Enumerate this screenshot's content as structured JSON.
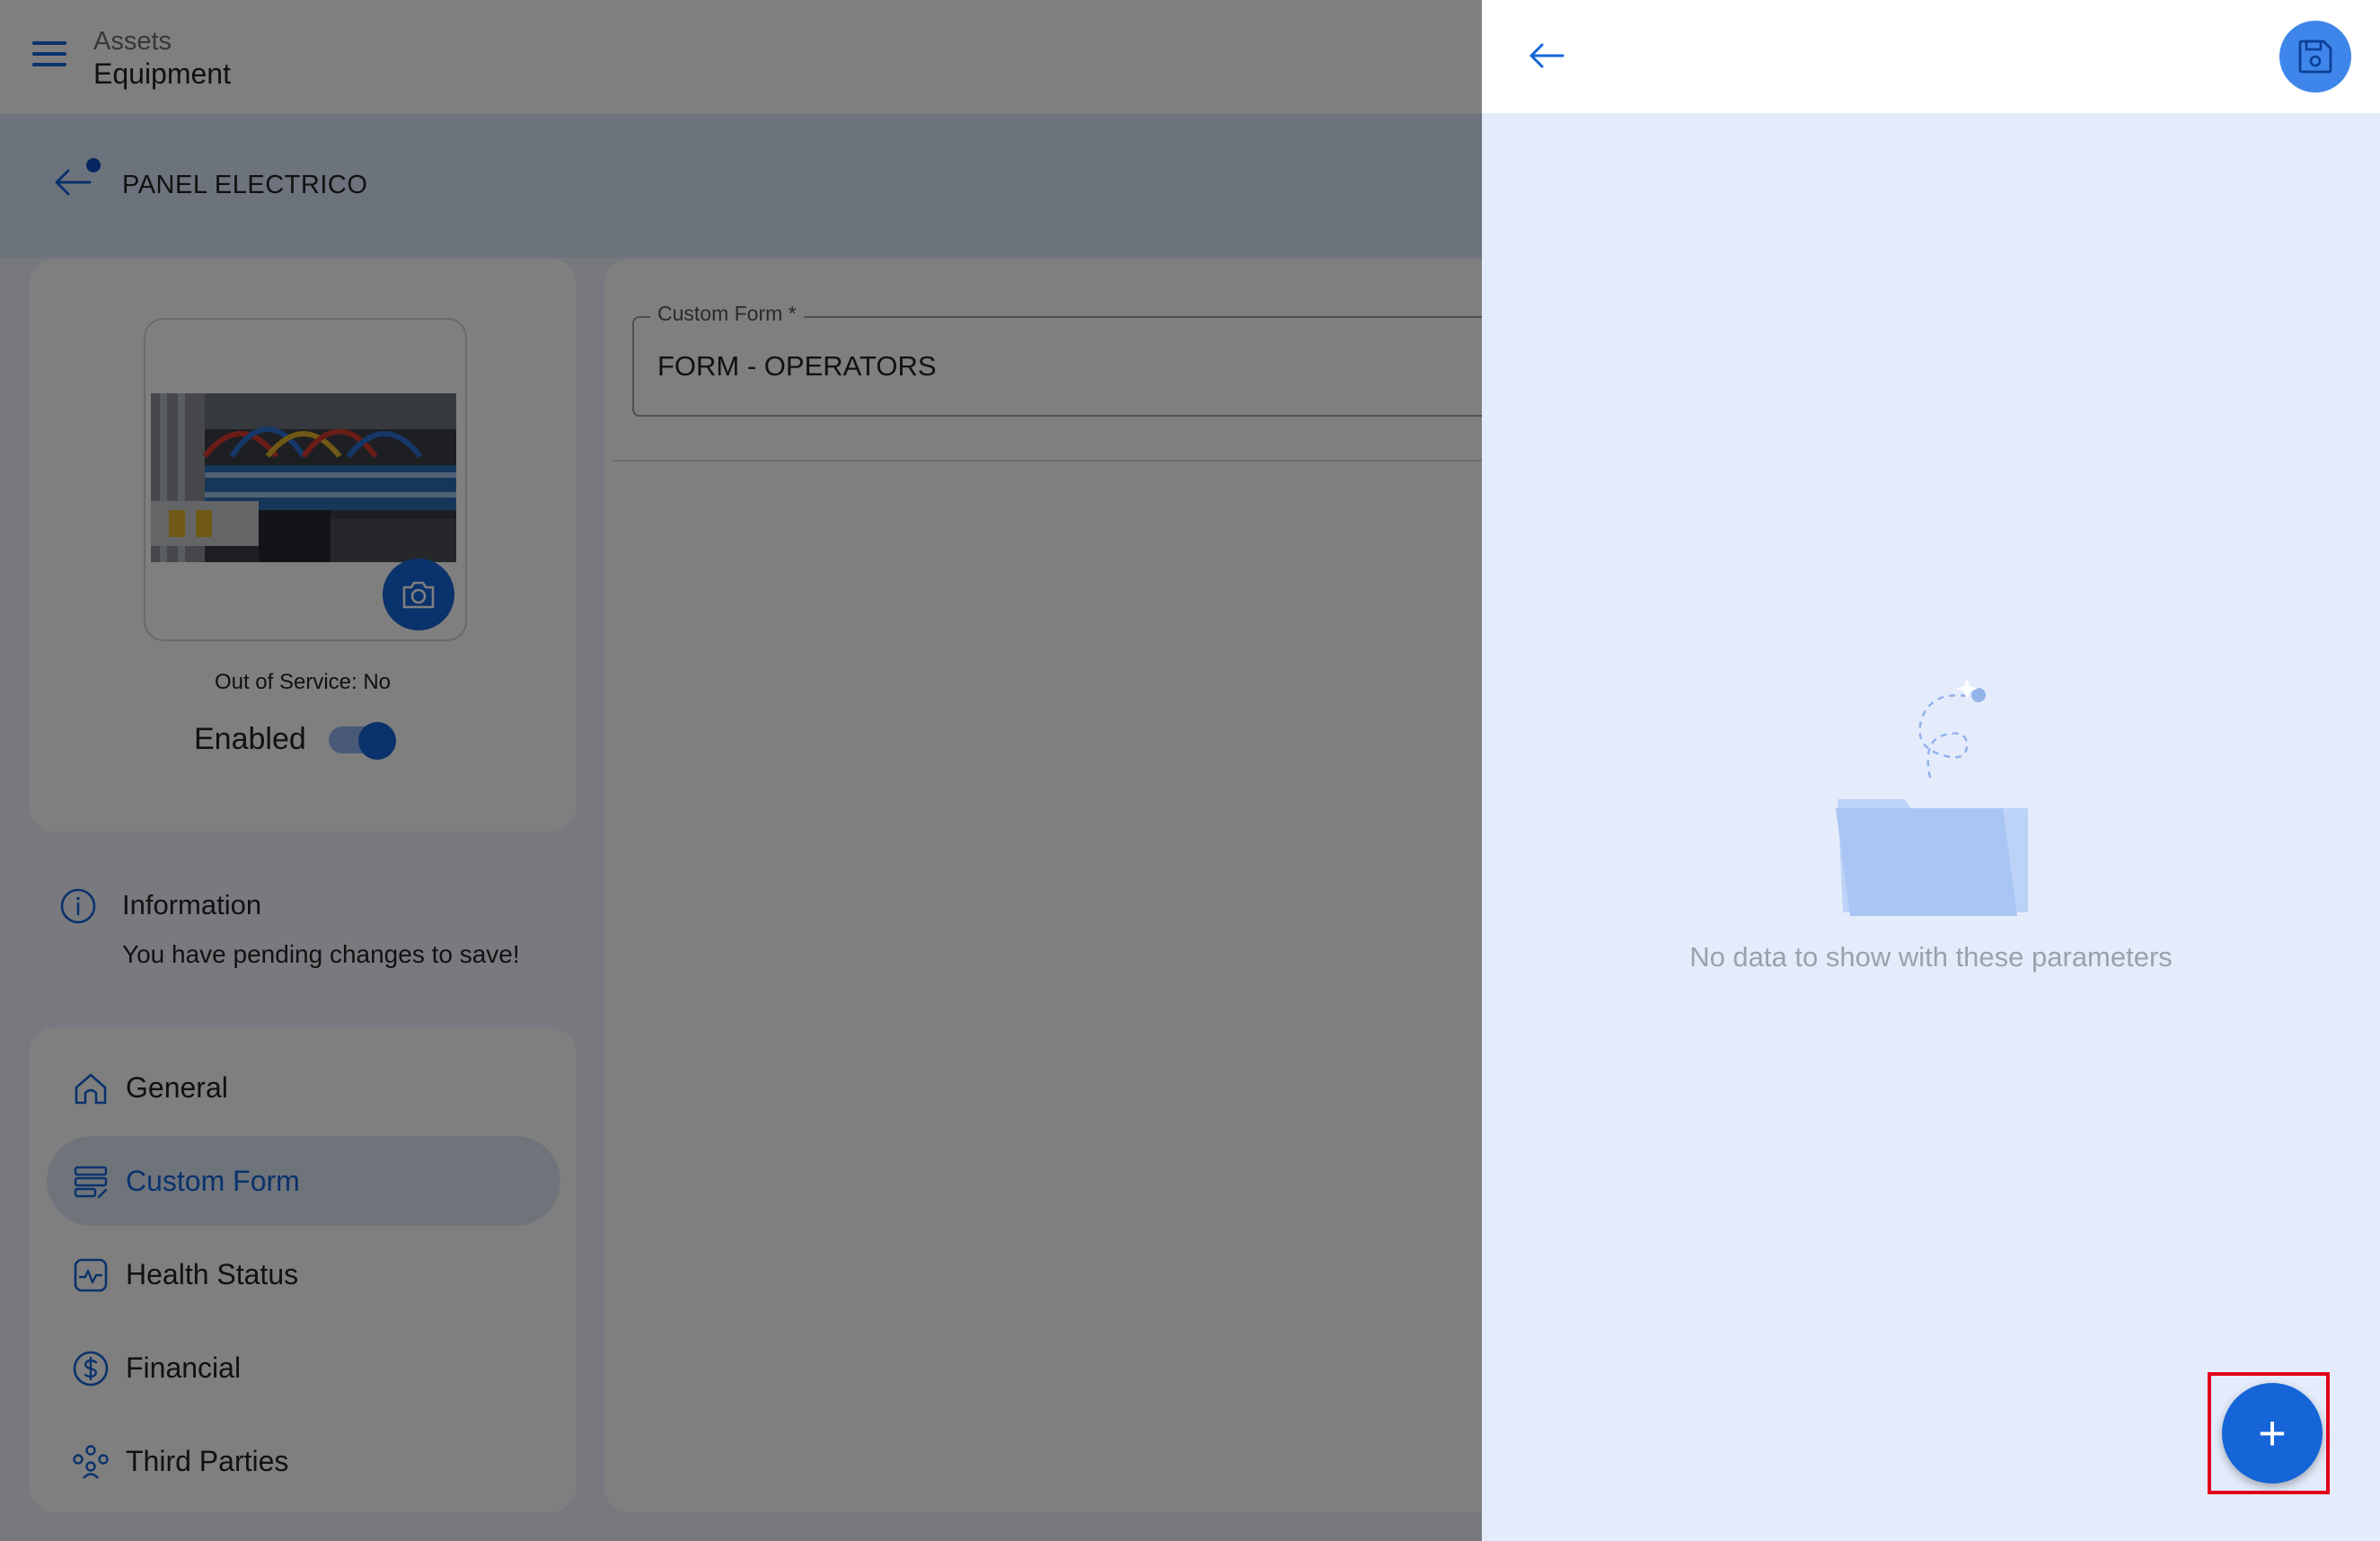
{
  "header": {
    "section": "Assets",
    "page": "Equipment"
  },
  "asset": {
    "title": "PANEL ELECTRICO"
  },
  "photo_card": {
    "out_of_service": "Out of Service: No",
    "enabled_label": "Enabled",
    "enabled": true
  },
  "info": {
    "title": "Information",
    "message": "You have pending changes to save!"
  },
  "nav": {
    "items": [
      {
        "label": "General",
        "icon": "home-icon"
      },
      {
        "label": "Custom Form",
        "icon": "form-icon",
        "active": true
      },
      {
        "label": "Health Status",
        "icon": "pulse-icon"
      },
      {
        "label": "Financial",
        "icon": "dollar-icon"
      },
      {
        "label": "Third Parties",
        "icon": "group-icon"
      }
    ]
  },
  "form": {
    "field_label": "Custom Form *",
    "field_value": "FORM - OPERATORS"
  },
  "panel": {
    "empty_message": "No data to show with these parameters",
    "fab_label": "+"
  },
  "colors": {
    "primary": "#1565d8",
    "panel_bg": "#e4ecfc",
    "highlight": "#e3001b"
  }
}
